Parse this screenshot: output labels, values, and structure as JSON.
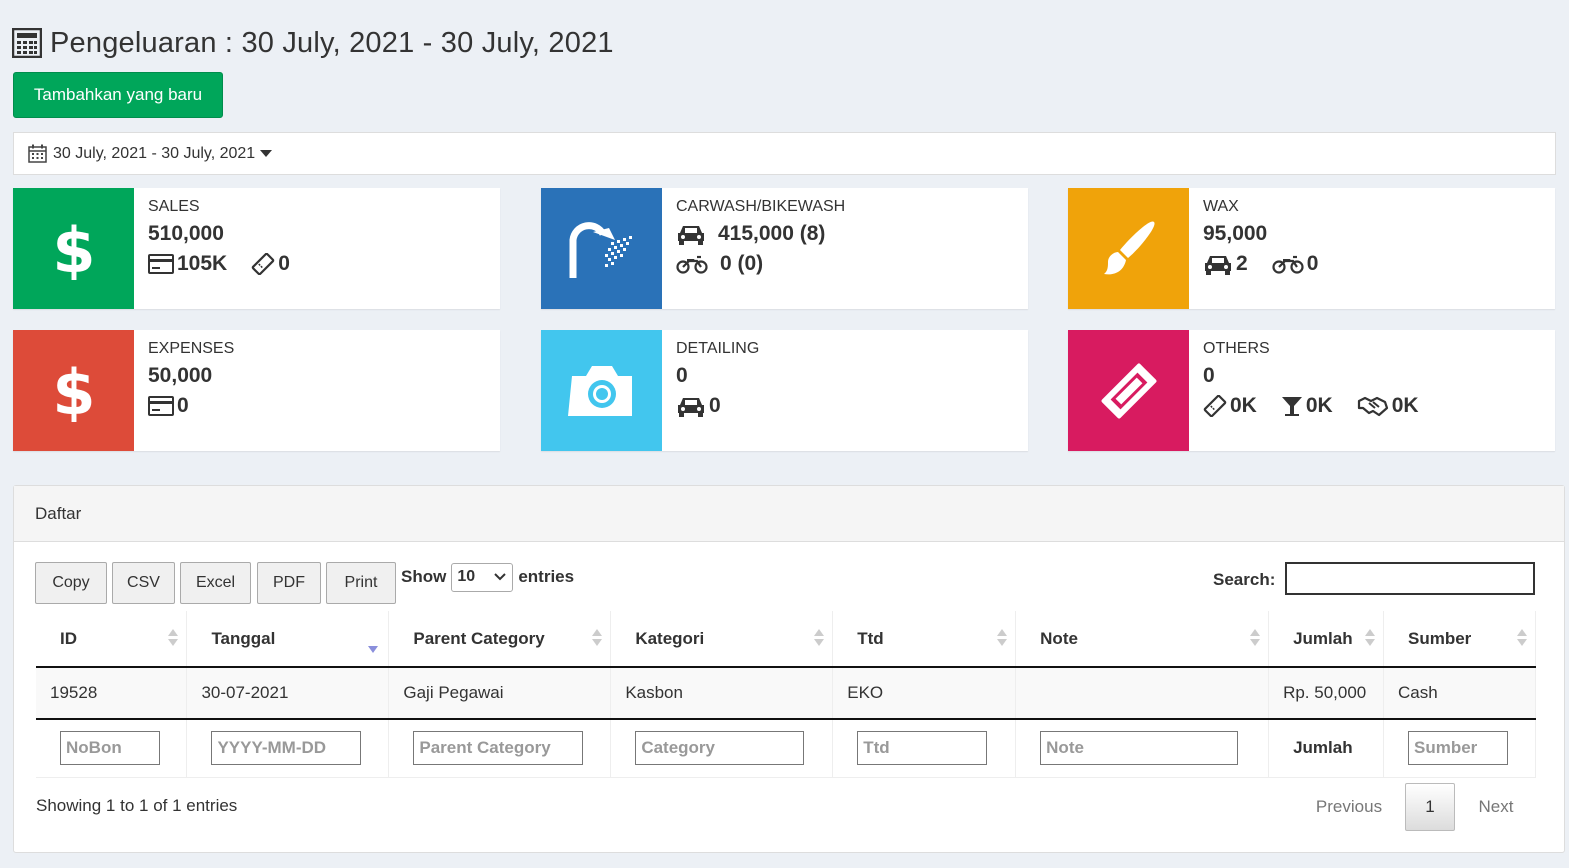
{
  "header": {
    "title": "Pengeluaran : 30 July, 2021 - 30 July, 2021",
    "icon": "calculator-icon"
  },
  "add_button": "Tambahkan yang baru",
  "date_range": {
    "label": "30 July, 2021 - 30 July, 2021",
    "icon": "calendar-icon"
  },
  "colors": {
    "green": "#00a65a",
    "blue": "#2a72b8",
    "orange": "#f0a30a",
    "red": "#dd4b39",
    "aqua": "#42c6ee",
    "maroon": "#d81b60"
  },
  "boxes": {
    "sales": {
      "title": "SALES",
      "value": "510,000",
      "card": "105K",
      "voucher": "0"
    },
    "carwash": {
      "title": "CARWASH/BIKEWASH",
      "car": "415,000 (8)",
      "bike": "0 (0)"
    },
    "wax": {
      "title": "WAX",
      "value": "95,000",
      "car": "2",
      "bike": "0"
    },
    "expenses": {
      "title": "EXPENSES",
      "value": "50,000",
      "card": "0"
    },
    "detailing": {
      "title": "DETAILING",
      "value": "0",
      "car": "0"
    },
    "others": {
      "title": "OTHERS",
      "value": "0",
      "voucher": "0K",
      "drink": "0K",
      "handshake": "0K"
    }
  },
  "panel": {
    "title": "Daftar",
    "buttons": [
      "Copy",
      "CSV",
      "Excel",
      "PDF",
      "Print"
    ],
    "show_label": "Show",
    "entries_value": "10",
    "entries_label": "entries",
    "search_label": "Search:",
    "columns": [
      "ID",
      "Tanggal",
      "Parent Category",
      "Kategori",
      "Ttd",
      "Note",
      "Jumlah",
      "Sumber"
    ],
    "rows": [
      [
        "19528",
        "30-07-2021",
        "Gaji Pegawai",
        "Kasbon",
        "EKO",
        "",
        "Rp. 50,000",
        "Cash"
      ]
    ],
    "filters": [
      "NoBon",
      "YYYY-MM-DD",
      "Parent Category",
      "Category",
      "Ttd",
      "Note",
      "Jumlah",
      "Sumber"
    ],
    "info": "Showing 1 to 1 of 1 entries",
    "pager": {
      "previous": "Previous",
      "page": "1",
      "next": "Next"
    }
  }
}
